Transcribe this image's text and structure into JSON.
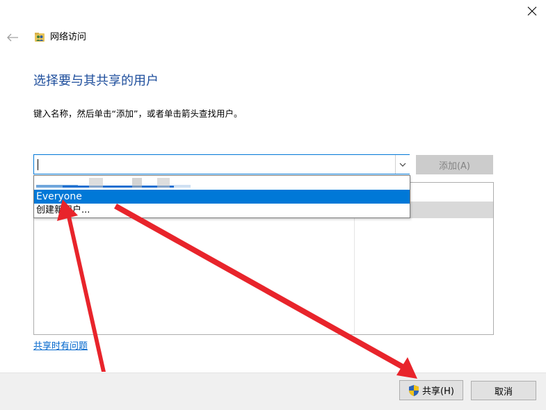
{
  "window": {
    "title": "网络访问",
    "close_icon": "close-icon",
    "back_icon": "back-arrow-icon",
    "app_icon": "users-folder-icon"
  },
  "main": {
    "heading": "选择要与其共享的用户",
    "instruction": "键入名称，然后单击“添加”，或者单击箭头查找用户。"
  },
  "combo": {
    "value": "",
    "dropdown_icon": "chevron-down-icon",
    "add_label": "添加(A)"
  },
  "dropdown": {
    "items": [
      {
        "label": "Everyone",
        "selected": true
      },
      {
        "label": "创建新用户..."
      }
    ]
  },
  "links": {
    "help": "共享时有问题"
  },
  "footer": {
    "share_label": "共享(H)",
    "share_icon": "uac-shield-icon",
    "cancel_label": "取消"
  },
  "colors": {
    "heading": "#1e4e9c",
    "accent": "#0078d7",
    "link": "#0066cc",
    "annotation_arrow": "#e8242b"
  }
}
